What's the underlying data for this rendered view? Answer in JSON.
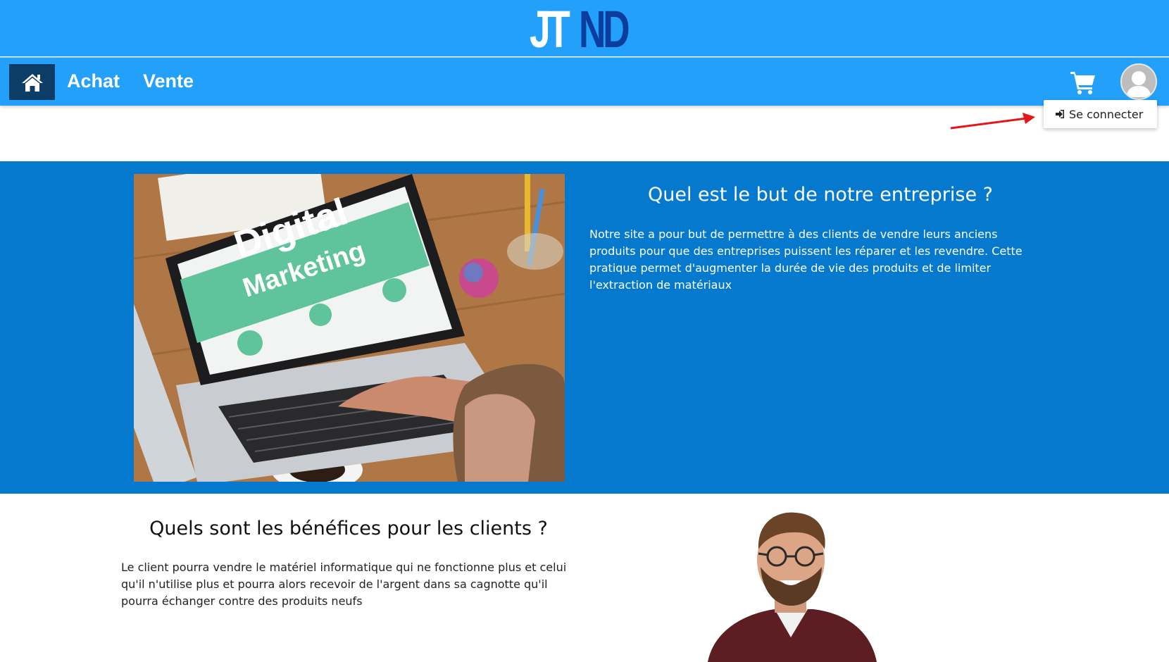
{
  "colors": {
    "header_bg": "#22a0fa",
    "home_btn_bg": "#0b3d67",
    "section_blue": "#0479cd",
    "logo_light": "#ffffff",
    "logo_dark": "#0a3d9e",
    "arrow": "#e5161b"
  },
  "header": {
    "logo_part1": "JT",
    "logo_part2": "ND"
  },
  "nav": {
    "home_icon": "home-icon",
    "links": [
      "Achat",
      "Vente"
    ],
    "cart_icon": "shopping-cart-icon",
    "avatar_icon": "user-avatar-icon"
  },
  "dropdown": {
    "icon": "sign-in-icon",
    "label": "Se connecter"
  },
  "section1": {
    "image_text_line1": "Digital",
    "image_text_line2": "Marketing",
    "title": "Quel est le but de notre entreprise ?",
    "text": "Notre site a pour but de permettre à des clients de vendre leurs anciens produits pour que des entreprises puissent les réparer et les revendre. Cette pratique permet d'augmenter la durée de vie des produits et de limiter l'extraction de matériaux"
  },
  "section2": {
    "title": "Quels sont les bénéfices pour les clients ?",
    "text": "Le client pourra vendre le matériel informatique qui ne fonctionne plus et celui qu'il n'utilise plus et pourra alors recevoir de l'argent dans sa cagnotte qu'il pourra échanger contre des produits neufs"
  }
}
